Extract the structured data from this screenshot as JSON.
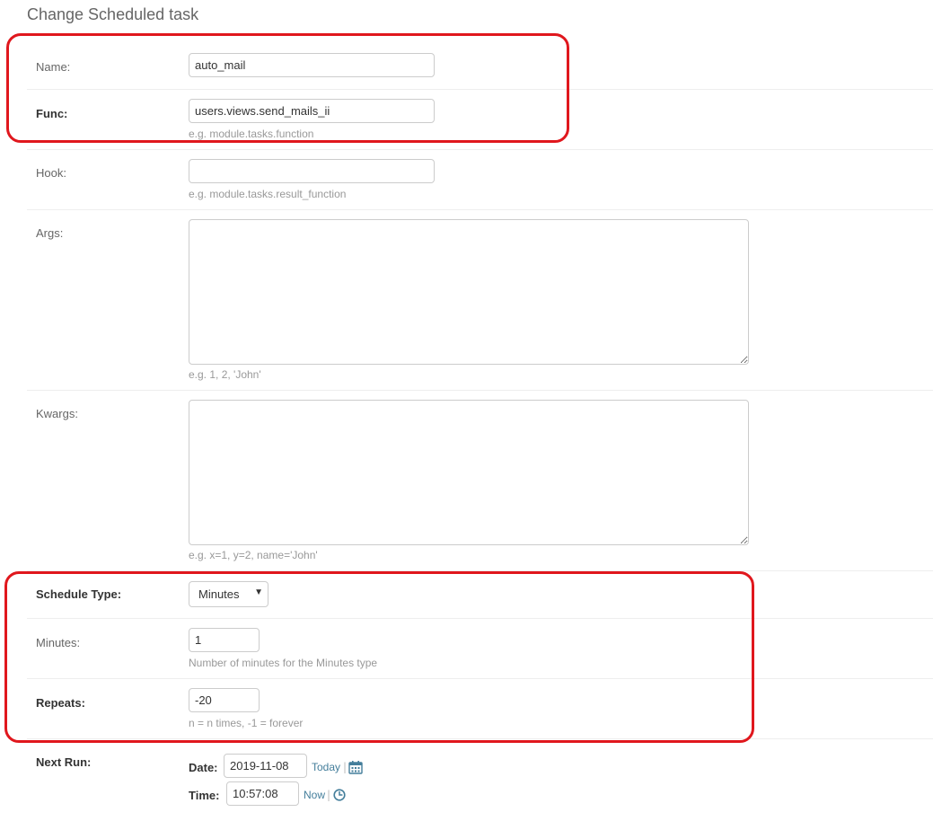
{
  "page": {
    "title": "Change Scheduled task"
  },
  "fields": {
    "name": {
      "label": "Name:",
      "value": "auto_mail"
    },
    "func": {
      "label": "Func:",
      "value": "users.views.send_mails_ii",
      "help": "e.g. module.tasks.function"
    },
    "hook": {
      "label": "Hook:",
      "value": "",
      "help": "e.g. module.tasks.result_function"
    },
    "args": {
      "label": "Args:",
      "value": "",
      "help": "e.g. 1, 2, 'John'"
    },
    "kwargs": {
      "label": "Kwargs:",
      "value": "",
      "help": "e.g. x=1, y=2, name='John'"
    },
    "schedule_type": {
      "label": "Schedule Type:",
      "selected": "Minutes"
    },
    "minutes": {
      "label": "Minutes:",
      "value": "1",
      "help": "Number of minutes for the Minutes type"
    },
    "repeats": {
      "label": "Repeats:",
      "value": "-20",
      "help": "n = n times, -1 = forever"
    },
    "next_run": {
      "label": "Next Run:",
      "date_label": "Date:",
      "date_value": "2019-11-08",
      "today_link": "Today",
      "time_label": "Time:",
      "time_value": "10:57:08",
      "now_link": "Now",
      "separator": "|"
    }
  },
  "colors": {
    "highlight": "#e0171d",
    "link": "#447e9b"
  },
  "icons": {
    "calendar": "calendar-icon",
    "clock": "clock-icon"
  }
}
